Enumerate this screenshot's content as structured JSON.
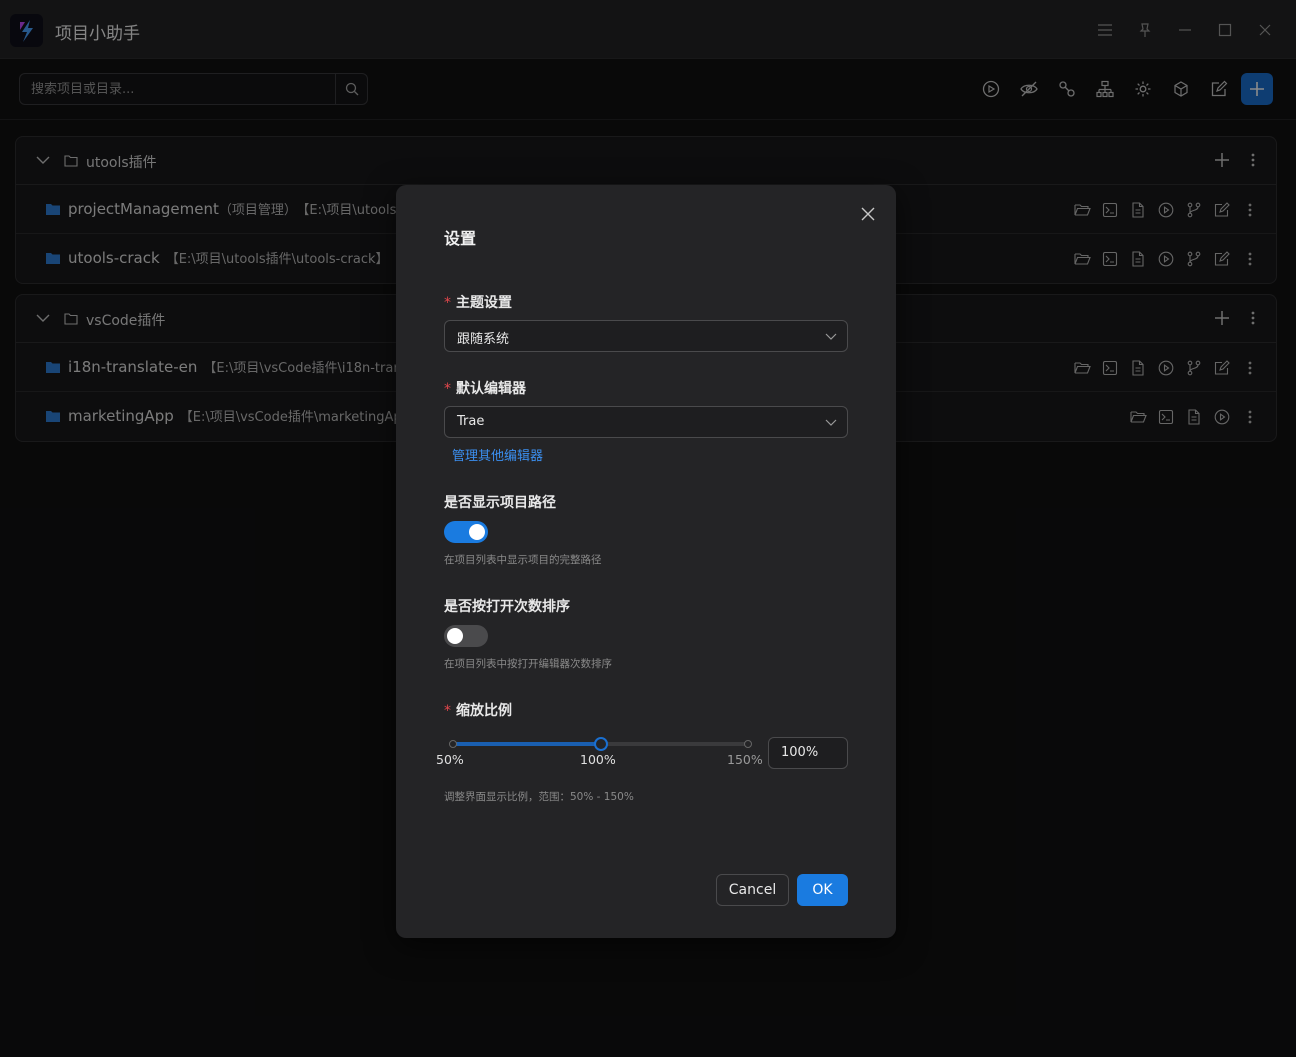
{
  "app": {
    "title": "项目小助手"
  },
  "search": {
    "placeholder": "搜索项目或目录..."
  },
  "groups": [
    {
      "name": "utools插件",
      "rows": [
        {
          "name": "projectManagement",
          "alias": "（项目管理）",
          "path": "【E:\\项目\\utools"
        },
        {
          "name": "utools-crack",
          "alias": "",
          "path": "【E:\\项目\\utools插件\\utools-crack】"
        }
      ]
    },
    {
      "name": "vsCode插件",
      "rows": [
        {
          "name": "i18n-translate-en",
          "alias": "",
          "path": "【E:\\项目\\vsCode插件\\i18n-trans"
        },
        {
          "name": "marketingApp",
          "alias": "",
          "path": "【E:\\项目\\vsCode插件\\marketingAp"
        }
      ]
    }
  ],
  "dialog": {
    "title": "设置",
    "theme": {
      "label": "主题设置",
      "value": "跟随系统"
    },
    "editor": {
      "label": "默认编辑器",
      "value": "Trae",
      "manage_link": "管理其他编辑器"
    },
    "show_path": {
      "label": "是否显示项目路径",
      "on": true,
      "help": "在项目列表中显示项目的完整路径"
    },
    "sort_by_open": {
      "label": "是否按打开次数排序",
      "on": false,
      "help": "在项目列表中按打开编辑器次数排序"
    },
    "zoom": {
      "label": "缩放比例",
      "value": 100,
      "display": "100%",
      "min": 50,
      "max": 150,
      "marks": [
        "50%",
        "100%",
        "150%"
      ],
      "help": "调整界面显示比例，范围：50% - 150%"
    },
    "cancel_label": "Cancel",
    "ok_label": "OK"
  },
  "colors": {
    "accent": "#1a7be0",
    "folder": "#2f7fd8",
    "required": "#e5484d"
  }
}
